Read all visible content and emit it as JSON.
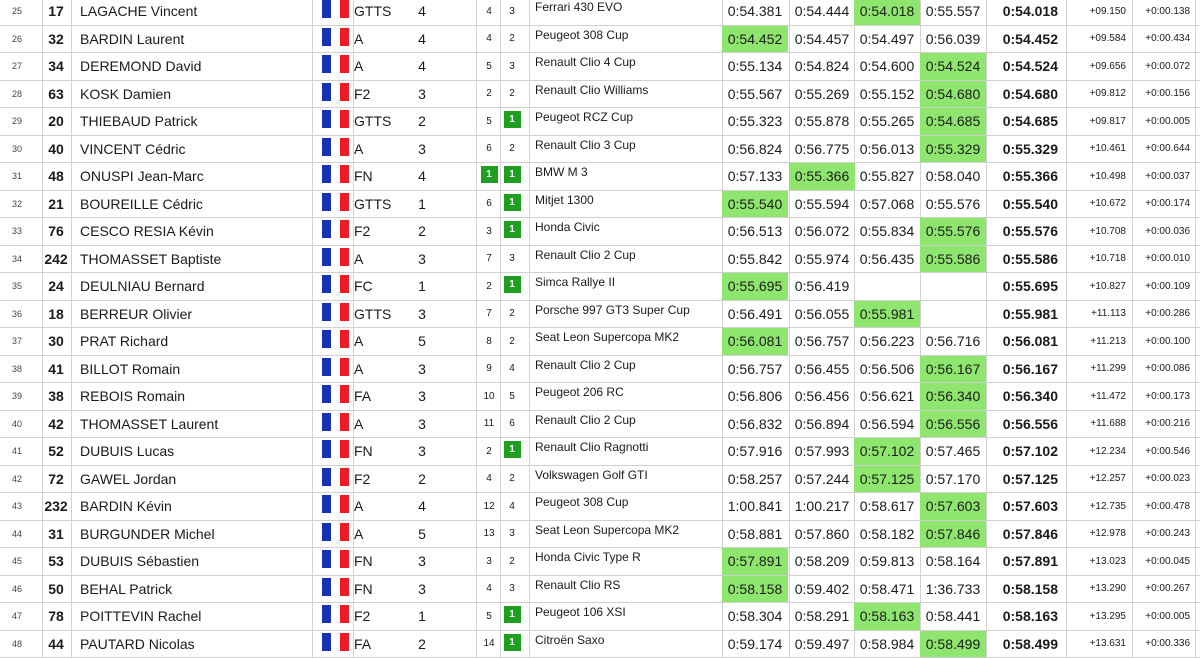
{
  "colors": {
    "highlight": "#8fe66e",
    "badge": "#1f9e22",
    "flag_blue": "#1733b4",
    "flag_white": "#ffffff",
    "flag_red": "#ec1c24"
  },
  "icons": {
    "flag": "france-flag-icon"
  },
  "rows": [
    {
      "pos": "25",
      "num": "17",
      "name": "LAGACHE Vincent",
      "group": "GTTS",
      "cls": "4",
      "c1": "4",
      "c2": "3",
      "c2_badge": false,
      "c1_badge": false,
      "car": "Ferrari 430 EVO",
      "times": [
        "0:54.381",
        "0:54.444",
        "0:54.018",
        "0:55.557"
      ],
      "hl": 2,
      "best": "0:54.018",
      "gap": "+09.150",
      "diff": "+0:00.138"
    },
    {
      "pos": "26",
      "num": "32",
      "name": "BARDIN Laurent",
      "group": "A",
      "cls": "4",
      "c1": "4",
      "c2": "2",
      "c2_badge": false,
      "c1_badge": false,
      "car": "Peugeot 308 Cup",
      "times": [
        "0:54.452",
        "0:54.457",
        "0:54.497",
        "0:56.039"
      ],
      "hl": 0,
      "best": "0:54.452",
      "gap": "+09.584",
      "diff": "+0:00.434"
    },
    {
      "pos": "27",
      "num": "34",
      "name": "DEREMOND David",
      "group": "A",
      "cls": "4",
      "c1": "5",
      "c2": "3",
      "c2_badge": false,
      "c1_badge": false,
      "car": "Renault Clio 4 Cup",
      "times": [
        "0:55.134",
        "0:54.824",
        "0:54.600",
        "0:54.524"
      ],
      "hl": 3,
      "best": "0:54.524",
      "gap": "+09.656",
      "diff": "+0:00.072"
    },
    {
      "pos": "28",
      "num": "63",
      "name": "KOSK Damien",
      "group": "F2",
      "cls": "3",
      "c1": "2",
      "c2": "2",
      "c2_badge": false,
      "c1_badge": false,
      "car": "Renault Clio Williams",
      "times": [
        "0:55.567",
        "0:55.269",
        "0:55.152",
        "0:54.680"
      ],
      "hl": 3,
      "best": "0:54.680",
      "gap": "+09.812",
      "diff": "+0:00.156"
    },
    {
      "pos": "29",
      "num": "20",
      "name": "THIEBAUD Patrick",
      "group": "GTTS",
      "cls": "2",
      "c1": "5",
      "c2": "1",
      "c2_badge": true,
      "c1_badge": false,
      "car": "Peugeot RCZ Cup",
      "times": [
        "0:55.323",
        "0:55.878",
        "0:55.265",
        "0:54.685"
      ],
      "hl": 3,
      "best": "0:54.685",
      "gap": "+09.817",
      "diff": "+0:00.005"
    },
    {
      "pos": "30",
      "num": "40",
      "name": "VINCENT Cédric",
      "group": "A",
      "cls": "3",
      "c1": "6",
      "c2": "2",
      "c2_badge": false,
      "c1_badge": false,
      "car": "Renault Clio 3 Cup",
      "times": [
        "0:56.824",
        "0:56.775",
        "0:56.013",
        "0:55.329"
      ],
      "hl": 3,
      "best": "0:55.329",
      "gap": "+10.461",
      "diff": "+0:00.644"
    },
    {
      "pos": "31",
      "num": "48",
      "name": "ONUSPI Jean-Marc",
      "group": "FN",
      "cls": "4",
      "c1": "1",
      "c2": "1",
      "c2_badge": true,
      "c1_badge": true,
      "car": "BMW M 3",
      "times": [
        "0:57.133",
        "0:55.366",
        "0:55.827",
        "0:58.040"
      ],
      "hl": 1,
      "best": "0:55.366",
      "gap": "+10.498",
      "diff": "+0:00.037"
    },
    {
      "pos": "32",
      "num": "21",
      "name": "BOUREILLE Cédric",
      "group": "GTTS",
      "cls": "1",
      "c1": "6",
      "c2": "1",
      "c2_badge": true,
      "c1_badge": false,
      "car": "Mitjet 1300",
      "times": [
        "0:55.540",
        "0:55.594",
        "0:57.068",
        "0:55.576"
      ],
      "hl": 0,
      "best": "0:55.540",
      "gap": "+10.672",
      "diff": "+0:00.174"
    },
    {
      "pos": "33",
      "num": "76",
      "name": "CESCO RESIA Kévin",
      "group": "F2",
      "cls": "2",
      "c1": "3",
      "c2": "1",
      "c2_badge": true,
      "c1_badge": false,
      "car": "Honda Civic",
      "times": [
        "0:56.513",
        "0:56.072",
        "0:55.834",
        "0:55.576"
      ],
      "hl": 3,
      "best": "0:55.576",
      "gap": "+10.708",
      "diff": "+0:00.036"
    },
    {
      "pos": "34",
      "num": "242",
      "name": "THOMASSET Baptiste",
      "group": "A",
      "cls": "3",
      "c1": "7",
      "c2": "3",
      "c2_badge": false,
      "c1_badge": false,
      "car": "Renault Clio 2 Cup",
      "times": [
        "0:55.842",
        "0:55.974",
        "0:56.435",
        "0:55.586"
      ],
      "hl": 3,
      "best": "0:55.586",
      "gap": "+10.718",
      "diff": "+0:00.010"
    },
    {
      "pos": "35",
      "num": "24",
      "name": "DEULNIAU Bernard",
      "group": "FC",
      "cls": "1",
      "c1": "2",
      "c2": "1",
      "c2_badge": true,
      "c1_badge": false,
      "car": "Simca Rallye II",
      "times": [
        "0:55.695",
        "0:56.419",
        "",
        ""
      ],
      "hl": 0,
      "best": "0:55.695",
      "gap": "+10.827",
      "diff": "+0:00.109"
    },
    {
      "pos": "36",
      "num": "18",
      "name": "BERREUR Olivier",
      "group": "GTTS",
      "cls": "3",
      "c1": "7",
      "c2": "2",
      "c2_badge": false,
      "c1_badge": false,
      "car": "Porsche 997 GT3 Super Cup",
      "times": [
        "0:56.491",
        "0:56.055",
        "0:55.981",
        ""
      ],
      "hl": 2,
      "best": "0:55.981",
      "gap": "+11.113",
      "diff": "+0:00.286"
    },
    {
      "pos": "37",
      "num": "30",
      "name": "PRAT Richard",
      "group": "A",
      "cls": "5",
      "c1": "8",
      "c2": "2",
      "c2_badge": false,
      "c1_badge": false,
      "car": "Seat Leon Supercopa MK2",
      "times": [
        "0:56.081",
        "0:56.757",
        "0:56.223",
        "0:56.716"
      ],
      "hl": 0,
      "best": "0:56.081",
      "gap": "+11.213",
      "diff": "+0:00.100"
    },
    {
      "pos": "38",
      "num": "41",
      "name": "BILLOT Romain",
      "group": "A",
      "cls": "3",
      "c1": "9",
      "c2": "4",
      "c2_badge": false,
      "c1_badge": false,
      "car": "Renault Clio 2 Cup",
      "times": [
        "0:56.757",
        "0:56.455",
        "0:56.506",
        "0:56.167"
      ],
      "hl": 3,
      "best": "0:56.167",
      "gap": "+11.299",
      "diff": "+0:00.086"
    },
    {
      "pos": "39",
      "num": "38",
      "name": "REBOIS Romain",
      "group": "FA",
      "cls": "3",
      "c1": "10",
      "c2": "5",
      "c2_badge": false,
      "c1_badge": false,
      "car": "Peugeot 206 RC",
      "times": [
        "0:56.806",
        "0:56.456",
        "0:56.621",
        "0:56.340"
      ],
      "hl": 3,
      "best": "0:56.340",
      "gap": "+11.472",
      "diff": "+0:00.173"
    },
    {
      "pos": "40",
      "num": "42",
      "name": "THOMASSET Laurent",
      "group": "A",
      "cls": "3",
      "c1": "11",
      "c2": "6",
      "c2_badge": false,
      "c1_badge": false,
      "car": "Renault Clio 2 Cup",
      "times": [
        "0:56.832",
        "0:56.894",
        "0:56.594",
        "0:56.556"
      ],
      "hl": 3,
      "best": "0:56.556",
      "gap": "+11.688",
      "diff": "+0:00.216"
    },
    {
      "pos": "41",
      "num": "52",
      "name": "DUBUIS Lucas",
      "group": "FN",
      "cls": "3",
      "c1": "2",
      "c2": "1",
      "c2_badge": true,
      "c1_badge": false,
      "car": "Renault Clio Ragnotti",
      "times": [
        "0:57.916",
        "0:57.993",
        "0:57.102",
        "0:57.465"
      ],
      "hl": 2,
      "best": "0:57.102",
      "gap": "+12.234",
      "diff": "+0:00.546"
    },
    {
      "pos": "42",
      "num": "72",
      "name": "GAWEL Jordan",
      "group": "F2",
      "cls": "2",
      "c1": "4",
      "c2": "2",
      "c2_badge": false,
      "c1_badge": false,
      "car": "Volkswagen Golf GTI",
      "times": [
        "0:58.257",
        "0:57.244",
        "0:57.125",
        "0:57.170"
      ],
      "hl": 2,
      "best": "0:57.125",
      "gap": "+12.257",
      "diff": "+0:00.023"
    },
    {
      "pos": "43",
      "num": "232",
      "name": "BARDIN Kévin",
      "group": "A",
      "cls": "4",
      "c1": "12",
      "c2": "4",
      "c2_badge": false,
      "c1_badge": false,
      "car": "Peugeot 308 Cup",
      "times": [
        "1:00.841",
        "1:00.217",
        "0:58.617",
        "0:57.603"
      ],
      "hl": 3,
      "best": "0:57.603",
      "gap": "+12.735",
      "diff": "+0:00.478"
    },
    {
      "pos": "44",
      "num": "31",
      "name": "BURGUNDER Michel",
      "group": "A",
      "cls": "5",
      "c1": "13",
      "c2": "3",
      "c2_badge": false,
      "c1_badge": false,
      "car": "Seat Leon Supercopa MK2",
      "times": [
        "0:58.881",
        "0:57.860",
        "0:58.182",
        "0:57.846"
      ],
      "hl": 3,
      "best": "0:57.846",
      "gap": "+12.978",
      "diff": "+0:00.243"
    },
    {
      "pos": "45",
      "num": "53",
      "name": "DUBUIS Sébastien",
      "group": "FN",
      "cls": "3",
      "c1": "3",
      "c2": "2",
      "c2_badge": false,
      "c1_badge": false,
      "car": "Honda Civic Type R",
      "times": [
        "0:57.891",
        "0:58.209",
        "0:59.813",
        "0:58.164"
      ],
      "hl": 0,
      "best": "0:57.891",
      "gap": "+13.023",
      "diff": "+0:00.045"
    },
    {
      "pos": "46",
      "num": "50",
      "name": "BEHAL Patrick",
      "group": "FN",
      "cls": "3",
      "c1": "4",
      "c2": "3",
      "c2_badge": false,
      "c1_badge": false,
      "car": "Renault Clio RS",
      "times": [
        "0:58.158",
        "0:59.402",
        "0:58.471",
        "1:36.733"
      ],
      "hl": 0,
      "best": "0:58.158",
      "gap": "+13.290",
      "diff": "+0:00.267"
    },
    {
      "pos": "47",
      "num": "78",
      "name": "POITTEVIN Rachel",
      "group": "F2",
      "cls": "1",
      "c1": "5",
      "c2": "1",
      "c2_badge": true,
      "c1_badge": false,
      "car": "Peugeot 106 XSI",
      "times": [
        "0:58.304",
        "0:58.291",
        "0:58.163",
        "0:58.441"
      ],
      "hl": 2,
      "best": "0:58.163",
      "gap": "+13.295",
      "diff": "+0:00.005"
    },
    {
      "pos": "48",
      "num": "44",
      "name": "PAUTARD Nicolas",
      "group": "FA",
      "cls": "2",
      "c1": "14",
      "c2": "1",
      "c2_badge": true,
      "c1_badge": false,
      "car": "Citroën Saxo",
      "times": [
        "0:59.174",
        "0:59.497",
        "0:58.984",
        "0:58.499"
      ],
      "hl": 3,
      "best": "0:58.499",
      "gap": "+13.631",
      "diff": "+0:00.336"
    }
  ]
}
